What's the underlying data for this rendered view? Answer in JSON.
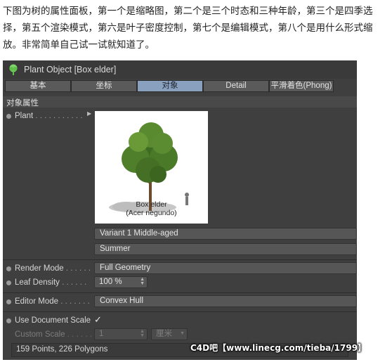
{
  "intro_text": "下图为树的属性面板，第一个是缩略图，第二个是三个时态和三种年龄，第三个是四季选择，第五个渲染模式，第六是叶子密度控制，第七个是编辑模式，第八个是用什么形式缩放。非常简单自己试一试就知道了。",
  "panel": {
    "title": "Plant Object [Box elder]",
    "title_icon": "tree-icon",
    "tabs": [
      "基本",
      "坐标",
      "对象",
      "Detail",
      "平滑着色(Phong)"
    ],
    "active_tab": "对象",
    "section_title": "对象属性",
    "plant": {
      "label": "Plant",
      "thumbnail_caption_1": "Box elder",
      "thumbnail_caption_2": "(Acer negundo)",
      "variant": "Variant 1 Middle-aged",
      "season": "Summer"
    },
    "render_mode": {
      "label": "Render Mode",
      "value": "Full Geometry"
    },
    "leaf_density": {
      "label": "Leaf Density",
      "value": "100 %"
    },
    "editor_mode": {
      "label": "Editor Mode",
      "value": "Convex Hull"
    },
    "use_document_scale": {
      "label": "Use Document Scale",
      "checked": true,
      "check_glyph": "✓"
    },
    "custom_scale": {
      "label": "Custom Scale",
      "value": "1",
      "unit": "厘米"
    },
    "status": "159 Points, 226 Polygons"
  },
  "watermark": "C4D吧【www.linecg.com/tieba/1799】"
}
